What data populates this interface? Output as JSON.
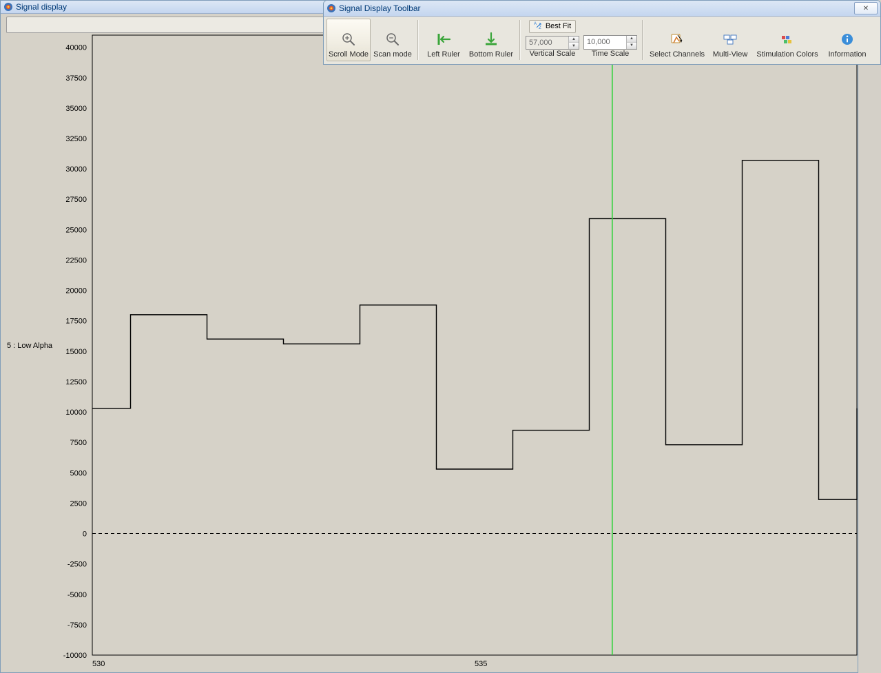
{
  "main_window": {
    "title": "Signal display"
  },
  "toolbar_window": {
    "title": "Signal Display Toolbar",
    "close": "✕"
  },
  "toolbar": {
    "scroll_mode": "Scroll Mode",
    "scan_mode": "Scan mode",
    "left_ruler": "Left Ruler",
    "bottom_ruler": "Bottom Ruler",
    "best_fit": "Best Fit",
    "vertical_scale_label": "Vertical Scale",
    "vertical_scale_value": "57,000",
    "time_scale_label": "Time Scale",
    "time_scale_value": "10,000",
    "select_channels": "Select Channels",
    "multi_view": "Multi-View",
    "stim_colors": "Stimulation Colors",
    "information": "Information"
  },
  "plot": {
    "channel_label": "5 : Low Alpha",
    "y_ticks": [
      40000,
      37500,
      35000,
      32500,
      30000,
      27500,
      25000,
      22500,
      20000,
      17500,
      15000,
      12500,
      10000,
      7500,
      5000,
      2500,
      0,
      -2500,
      -5000,
      -7500,
      -10000
    ],
    "x_ticks": [
      530,
      535
    ]
  },
  "chart_data": {
    "type": "line",
    "title": "",
    "channel": "5 : Low Alpha",
    "xlabel": "",
    "ylabel": "",
    "xlim": [
      530,
      540
    ],
    "ylim": [
      -10000,
      41000
    ],
    "cursor_x": 536.8,
    "series": [
      {
        "name": "Low Alpha",
        "x": [
          530.0,
          530.5,
          531.5,
          532.5,
          533.5,
          534.5,
          535.5,
          536.5,
          537.5,
          538.5,
          539.5
        ],
        "values": [
          10300,
          18000,
          16000,
          15600,
          18800,
          5300,
          8500,
          25900,
          7300,
          30700,
          2800
        ]
      }
    ],
    "trailing_rise_to": 10300
  }
}
